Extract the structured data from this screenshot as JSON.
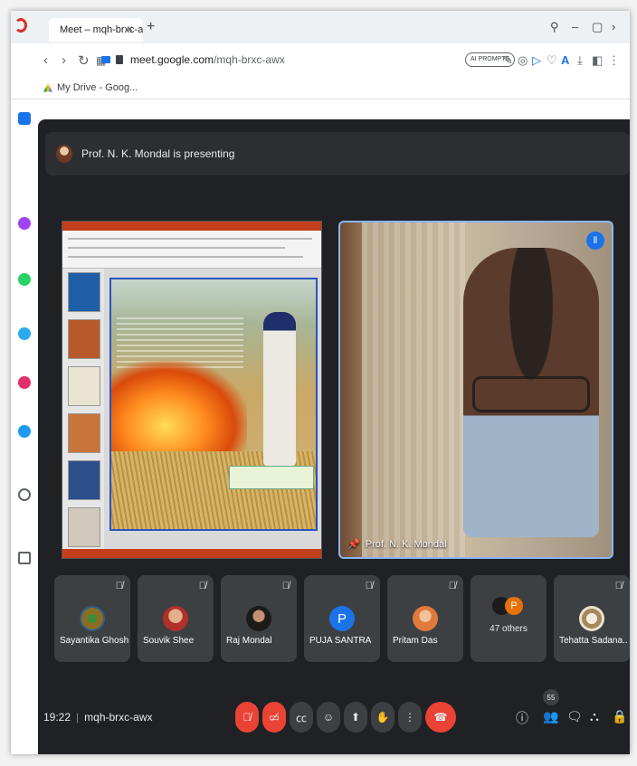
{
  "browser": {
    "tab_title": "Meet – mqh-brxc-aw",
    "tab_close": "×",
    "new_tab": "+",
    "url_domain": "meet.google.com",
    "url_path": "/mqh-brxc-awx",
    "ai_prompts": "AI PROMPTS",
    "bookmark": "My Drive - Goog..."
  },
  "meet": {
    "presenting_text": "Prof. N. K. Mondal is presenting",
    "presenter_name": "Prof. N. K. Mondal",
    "participants": [
      {
        "name": "Sayantika Ghosh",
        "avatar": "peacock-image",
        "color": "#7a6a2a"
      },
      {
        "name": "Souvik Shee",
        "avatar": "photo",
        "color": "#c77b5a"
      },
      {
        "name": "Raj Mondal",
        "avatar": "photo",
        "color": "#5a3b3b"
      },
      {
        "name": "PUJA SANTRA",
        "avatar_letter": "P",
        "color": "#1a73e8"
      },
      {
        "name": "Pritam Das",
        "avatar": "photo",
        "color": "#d9a07a"
      },
      {
        "name": "47 others",
        "avatar_letter": "P",
        "color": "#e8710a"
      },
      {
        "name": "Tehatta Sadana...",
        "avatar": "logo",
        "color": "#c9b28a"
      }
    ],
    "time": "19:22",
    "meeting_code": "mqh-brxc-awx",
    "people_count": "55"
  },
  "colors": {
    "meet_bg": "#202124",
    "tile_bg": "#3c4043",
    "danger": "#ea4335",
    "accent": "#1a73e8"
  }
}
